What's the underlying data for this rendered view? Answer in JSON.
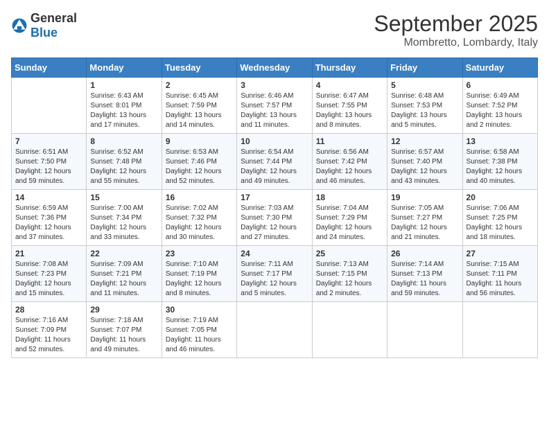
{
  "header": {
    "logo_general": "General",
    "logo_blue": "Blue",
    "month": "September 2025",
    "location": "Mombretto, Lombardy, Italy"
  },
  "weekdays": [
    "Sunday",
    "Monday",
    "Tuesday",
    "Wednesday",
    "Thursday",
    "Friday",
    "Saturday"
  ],
  "weeks": [
    [
      {
        "day": null
      },
      {
        "day": "1",
        "sunrise": "Sunrise: 6:43 AM",
        "sunset": "Sunset: 8:01 PM",
        "daylight": "Daylight: 13 hours and 17 minutes."
      },
      {
        "day": "2",
        "sunrise": "Sunrise: 6:45 AM",
        "sunset": "Sunset: 7:59 PM",
        "daylight": "Daylight: 13 hours and 14 minutes."
      },
      {
        "day": "3",
        "sunrise": "Sunrise: 6:46 AM",
        "sunset": "Sunset: 7:57 PM",
        "daylight": "Daylight: 13 hours and 11 minutes."
      },
      {
        "day": "4",
        "sunrise": "Sunrise: 6:47 AM",
        "sunset": "Sunset: 7:55 PM",
        "daylight": "Daylight: 13 hours and 8 minutes."
      },
      {
        "day": "5",
        "sunrise": "Sunrise: 6:48 AM",
        "sunset": "Sunset: 7:53 PM",
        "daylight": "Daylight: 13 hours and 5 minutes."
      },
      {
        "day": "6",
        "sunrise": "Sunrise: 6:49 AM",
        "sunset": "Sunset: 7:52 PM",
        "daylight": "Daylight: 13 hours and 2 minutes."
      }
    ],
    [
      {
        "day": "7",
        "sunrise": "Sunrise: 6:51 AM",
        "sunset": "Sunset: 7:50 PM",
        "daylight": "Daylight: 12 hours and 59 minutes."
      },
      {
        "day": "8",
        "sunrise": "Sunrise: 6:52 AM",
        "sunset": "Sunset: 7:48 PM",
        "daylight": "Daylight: 12 hours and 55 minutes."
      },
      {
        "day": "9",
        "sunrise": "Sunrise: 6:53 AM",
        "sunset": "Sunset: 7:46 PM",
        "daylight": "Daylight: 12 hours and 52 minutes."
      },
      {
        "day": "10",
        "sunrise": "Sunrise: 6:54 AM",
        "sunset": "Sunset: 7:44 PM",
        "daylight": "Daylight: 12 hours and 49 minutes."
      },
      {
        "day": "11",
        "sunrise": "Sunrise: 6:56 AM",
        "sunset": "Sunset: 7:42 PM",
        "daylight": "Daylight: 12 hours and 46 minutes."
      },
      {
        "day": "12",
        "sunrise": "Sunrise: 6:57 AM",
        "sunset": "Sunset: 7:40 PM",
        "daylight": "Daylight: 12 hours and 43 minutes."
      },
      {
        "day": "13",
        "sunrise": "Sunrise: 6:58 AM",
        "sunset": "Sunset: 7:38 PM",
        "daylight": "Daylight: 12 hours and 40 minutes."
      }
    ],
    [
      {
        "day": "14",
        "sunrise": "Sunrise: 6:59 AM",
        "sunset": "Sunset: 7:36 PM",
        "daylight": "Daylight: 12 hours and 37 minutes."
      },
      {
        "day": "15",
        "sunrise": "Sunrise: 7:00 AM",
        "sunset": "Sunset: 7:34 PM",
        "daylight": "Daylight: 12 hours and 33 minutes."
      },
      {
        "day": "16",
        "sunrise": "Sunrise: 7:02 AM",
        "sunset": "Sunset: 7:32 PM",
        "daylight": "Daylight: 12 hours and 30 minutes."
      },
      {
        "day": "17",
        "sunrise": "Sunrise: 7:03 AM",
        "sunset": "Sunset: 7:30 PM",
        "daylight": "Daylight: 12 hours and 27 minutes."
      },
      {
        "day": "18",
        "sunrise": "Sunrise: 7:04 AM",
        "sunset": "Sunset: 7:29 PM",
        "daylight": "Daylight: 12 hours and 24 minutes."
      },
      {
        "day": "19",
        "sunrise": "Sunrise: 7:05 AM",
        "sunset": "Sunset: 7:27 PM",
        "daylight": "Daylight: 12 hours and 21 minutes."
      },
      {
        "day": "20",
        "sunrise": "Sunrise: 7:06 AM",
        "sunset": "Sunset: 7:25 PM",
        "daylight": "Daylight: 12 hours and 18 minutes."
      }
    ],
    [
      {
        "day": "21",
        "sunrise": "Sunrise: 7:08 AM",
        "sunset": "Sunset: 7:23 PM",
        "daylight": "Daylight: 12 hours and 15 minutes."
      },
      {
        "day": "22",
        "sunrise": "Sunrise: 7:09 AM",
        "sunset": "Sunset: 7:21 PM",
        "daylight": "Daylight: 12 hours and 11 minutes."
      },
      {
        "day": "23",
        "sunrise": "Sunrise: 7:10 AM",
        "sunset": "Sunset: 7:19 PM",
        "daylight": "Daylight: 12 hours and 8 minutes."
      },
      {
        "day": "24",
        "sunrise": "Sunrise: 7:11 AM",
        "sunset": "Sunset: 7:17 PM",
        "daylight": "Daylight: 12 hours and 5 minutes."
      },
      {
        "day": "25",
        "sunrise": "Sunrise: 7:13 AM",
        "sunset": "Sunset: 7:15 PM",
        "daylight": "Daylight: 12 hours and 2 minutes."
      },
      {
        "day": "26",
        "sunrise": "Sunrise: 7:14 AM",
        "sunset": "Sunset: 7:13 PM",
        "daylight": "Daylight: 11 hours and 59 minutes."
      },
      {
        "day": "27",
        "sunrise": "Sunrise: 7:15 AM",
        "sunset": "Sunset: 7:11 PM",
        "daylight": "Daylight: 11 hours and 56 minutes."
      }
    ],
    [
      {
        "day": "28",
        "sunrise": "Sunrise: 7:16 AM",
        "sunset": "Sunset: 7:09 PM",
        "daylight": "Daylight: 11 hours and 52 minutes."
      },
      {
        "day": "29",
        "sunrise": "Sunrise: 7:18 AM",
        "sunset": "Sunset: 7:07 PM",
        "daylight": "Daylight: 11 hours and 49 minutes."
      },
      {
        "day": "30",
        "sunrise": "Sunrise: 7:19 AM",
        "sunset": "Sunset: 7:05 PM",
        "daylight": "Daylight: 11 hours and 46 minutes."
      },
      {
        "day": null
      },
      {
        "day": null
      },
      {
        "day": null
      },
      {
        "day": null
      }
    ]
  ]
}
